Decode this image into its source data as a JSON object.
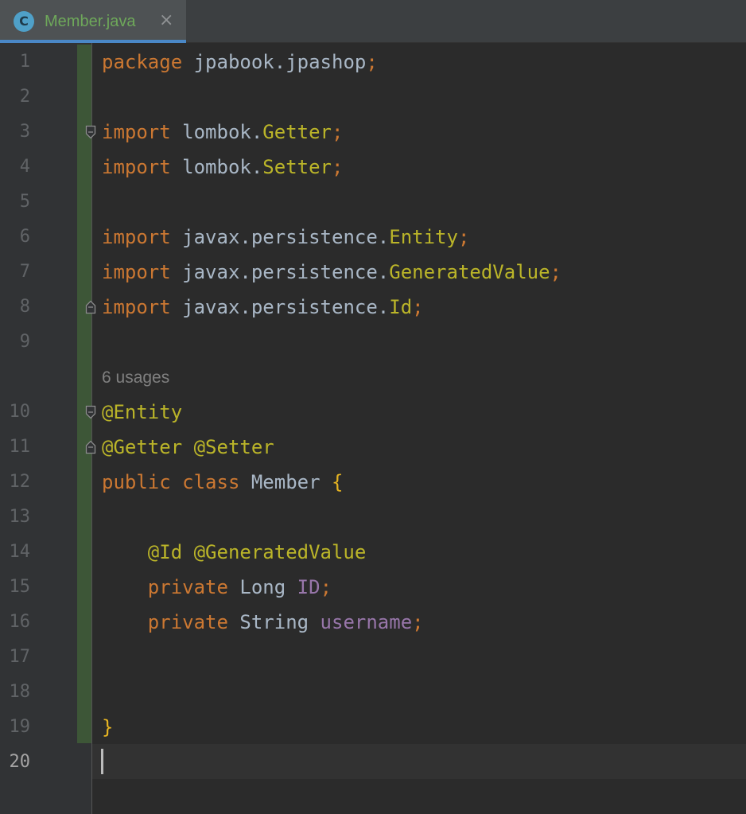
{
  "tab": {
    "title": "Member.java",
    "file_type_letter": "C",
    "close_glyph": "×"
  },
  "colors": {
    "keyword": "#cc7832",
    "annotation": "#bbb529",
    "field": "#9876aa",
    "brace": "#e6b422",
    "plain": "#a9b7c6",
    "hint": "#808080"
  },
  "icons": [
    "class-file-icon",
    "close-icon",
    "fold-open-icon",
    "fold-close-icon"
  ],
  "hint": "6 usages",
  "lines": [
    {
      "num": "1",
      "tokens": [
        {
          "t": "package",
          "k": "keyword"
        },
        {
          "t": " jpabook.jpashop",
          "k": "plain"
        },
        {
          "t": ";",
          "k": "keyword"
        }
      ]
    },
    {
      "num": "2",
      "tokens": []
    },
    {
      "num": "3",
      "tokens": [
        {
          "t": "import",
          "k": "keyword"
        },
        {
          "t": " lombok.",
          "k": "plain"
        },
        {
          "t": "Getter",
          "k": "annotation"
        },
        {
          "t": ";",
          "k": "keyword"
        }
      ]
    },
    {
      "num": "4",
      "tokens": [
        {
          "t": "import",
          "k": "keyword"
        },
        {
          "t": " lombok.",
          "k": "plain"
        },
        {
          "t": "Setter",
          "k": "annotation"
        },
        {
          "t": ";",
          "k": "keyword"
        }
      ]
    },
    {
      "num": "5",
      "tokens": []
    },
    {
      "num": "6",
      "tokens": [
        {
          "t": "import",
          "k": "keyword"
        },
        {
          "t": " javax.persistence.",
          "k": "plain"
        },
        {
          "t": "Entity",
          "k": "annotation"
        },
        {
          "t": ";",
          "k": "keyword"
        }
      ]
    },
    {
      "num": "7",
      "tokens": [
        {
          "t": "import",
          "k": "keyword"
        },
        {
          "t": " javax.persistence.",
          "k": "plain"
        },
        {
          "t": "GeneratedValue",
          "k": "annotation"
        },
        {
          "t": ";",
          "k": "keyword"
        }
      ]
    },
    {
      "num": "8",
      "tokens": [
        {
          "t": "import",
          "k": "keyword"
        },
        {
          "t": " javax.persistence.",
          "k": "plain"
        },
        {
          "t": "Id",
          "k": "annotation"
        },
        {
          "t": ";",
          "k": "keyword"
        }
      ]
    },
    {
      "num": "9",
      "tokens": []
    },
    {
      "num": "10",
      "tokens": [
        {
          "t": "@Entity",
          "k": "annotation"
        }
      ]
    },
    {
      "num": "11",
      "tokens": [
        {
          "t": "@Getter @Setter",
          "k": "annotation"
        }
      ]
    },
    {
      "num": "12",
      "tokens": [
        {
          "t": "public class",
          "k": "keyword"
        },
        {
          "t": " Member ",
          "k": "plain"
        },
        {
          "t": "{",
          "k": "brace"
        }
      ]
    },
    {
      "num": "13",
      "tokens": []
    },
    {
      "num": "14",
      "tokens": [
        {
          "t": "    @Id @GeneratedValue",
          "k": "annotation"
        }
      ]
    },
    {
      "num": "15",
      "tokens": [
        {
          "t": "    private",
          "k": "keyword"
        },
        {
          "t": " Long ",
          "k": "plain"
        },
        {
          "t": "ID",
          "k": "field"
        },
        {
          "t": ";",
          "k": "keyword"
        }
      ]
    },
    {
      "num": "16",
      "tokens": [
        {
          "t": "    private",
          "k": "keyword"
        },
        {
          "t": " String ",
          "k": "plain"
        },
        {
          "t": "username",
          "k": "field"
        },
        {
          "t": ";",
          "k": "keyword"
        }
      ]
    },
    {
      "num": "17",
      "tokens": []
    },
    {
      "num": "18",
      "tokens": []
    },
    {
      "num": "19",
      "tokens": [
        {
          "t": "}",
          "k": "brace"
        }
      ]
    },
    {
      "num": "20",
      "tokens": []
    }
  ]
}
